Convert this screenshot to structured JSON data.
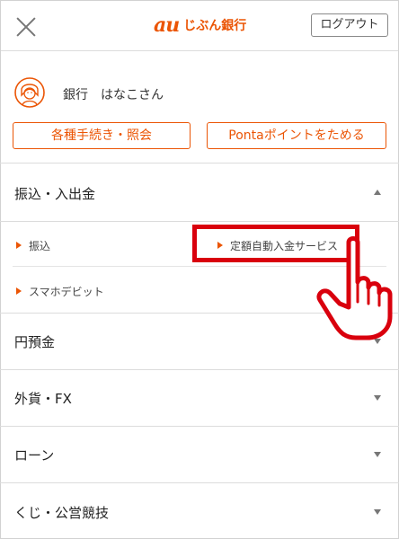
{
  "header": {
    "logo_mark": "au",
    "logo_text": "じぶん銀行",
    "logout_label": "ログアウト"
  },
  "user": {
    "greeting": "銀行　はなこさん",
    "procedures_button": "各種手続き・照会",
    "ponta_button": "Pontaポイントをためる"
  },
  "menu": {
    "transfer_section": {
      "label": "振込・入出金",
      "items": [
        {
          "label": "振込"
        },
        {
          "label": "定額自動入金サービス"
        },
        {
          "label": "スマホデビット"
        }
      ]
    },
    "yen_deposit": "円預金",
    "foreign_fx": "外貨・FX",
    "loan": "ローン",
    "lottery": "くじ・公営競技"
  },
  "colors": {
    "brand": "#eb5505",
    "highlight": "#d9000d"
  },
  "icons": [
    "close-icon",
    "avatar-icon",
    "chevron-up-icon",
    "chevron-down-icon",
    "arrow-right-icon",
    "pointing-hand-icon"
  ]
}
